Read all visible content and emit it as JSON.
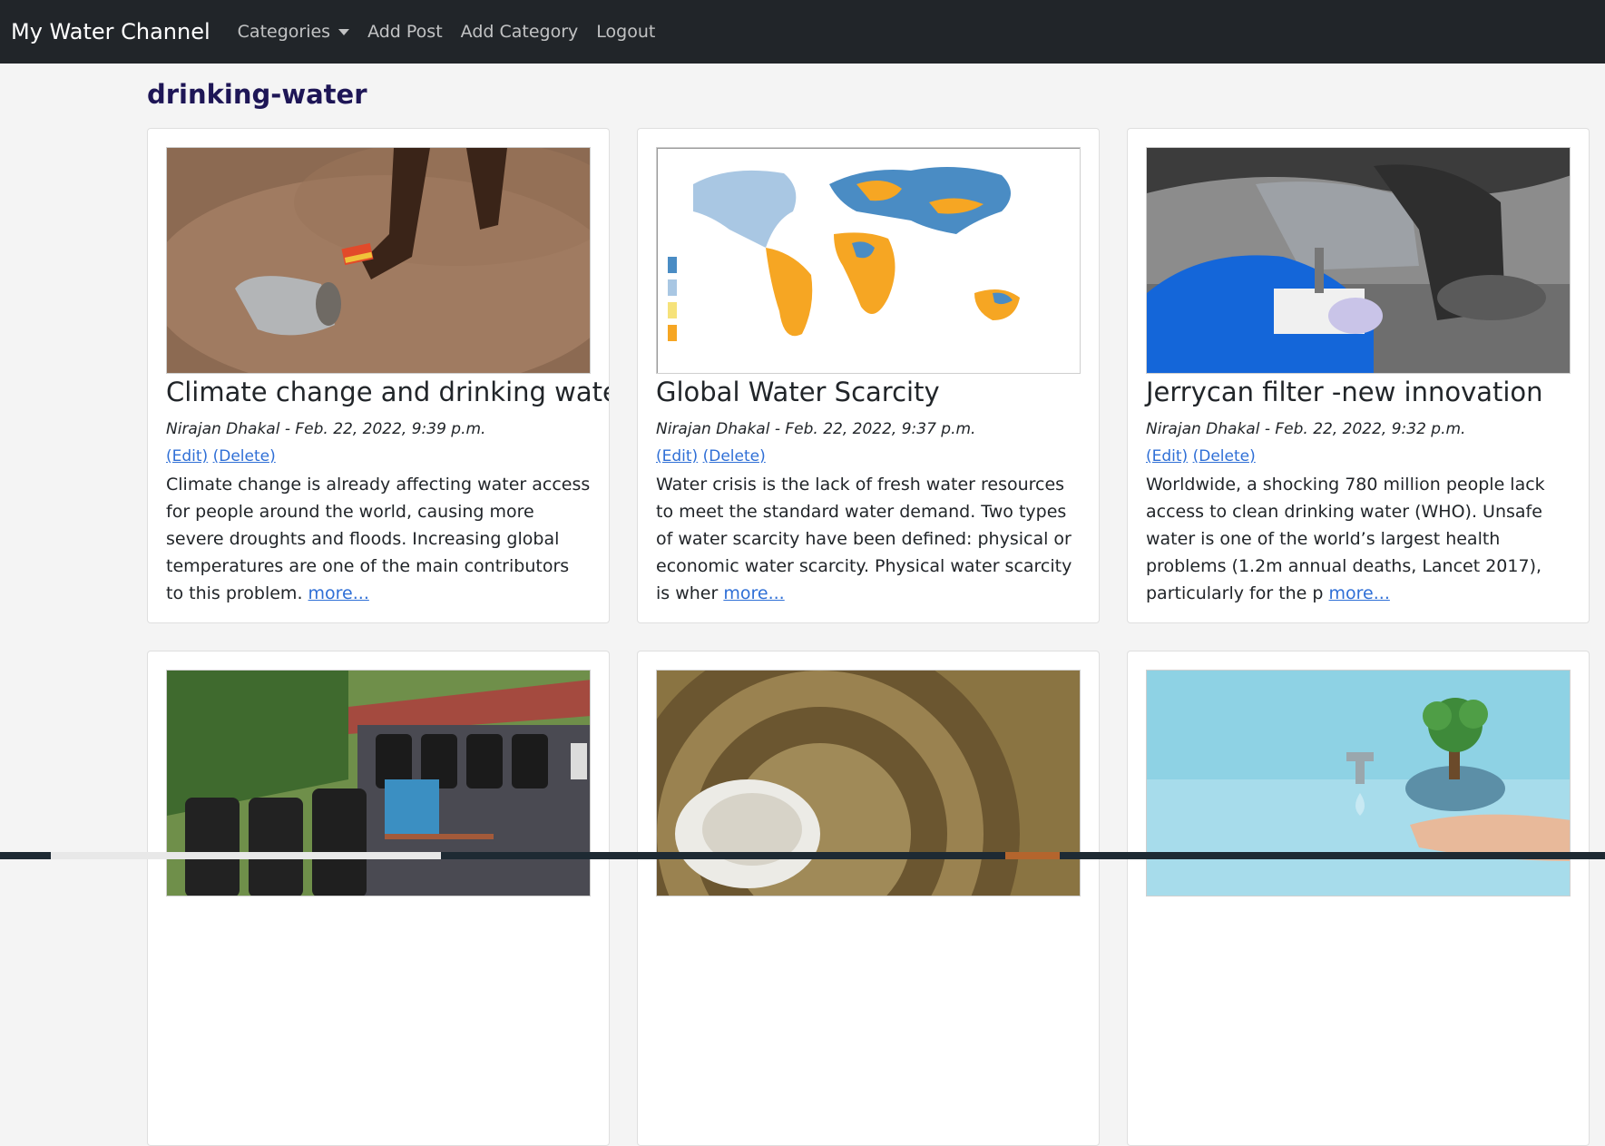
{
  "nav": {
    "brand": "My Water Channel",
    "categories_label": "Categories",
    "add_post_label": "Add Post",
    "add_category_label": "Add Category",
    "logout_label": "Logout"
  },
  "page": {
    "title": "drinking-water"
  },
  "posts": [
    {
      "title": "Climate change and drinking water",
      "meta": "Nirajan Dhakal - Feb. 22, 2022, 9:39 p.m.",
      "edit_label": "(Edit)",
      "delete_label": "(Delete)",
      "excerpt": "Climate change is already affecting water access for people around the world, causing more severe droughts and floods. Increasing global temperatures are one of the main contributors to this problem.",
      "more_label": "more..."
    },
    {
      "title": "Global Water Scarcity",
      "meta": "Nirajan Dhakal - Feb. 22, 2022, 9:37 p.m.",
      "edit_label": "(Edit)",
      "delete_label": "(Delete)",
      "excerpt": "Water crisis is the lack of fresh water resources to meet the standard water demand. Two types of water scarcity have been defined: physical or economic water scarcity. Physical water scarcity is wher",
      "more_label": "more..."
    },
    {
      "title": "Jerrycan filter -new innovation",
      "meta": "Nirajan Dhakal - Feb. 22, 2022, 9:32 p.m.",
      "edit_label": "(Edit)",
      "delete_label": "(Delete)",
      "excerpt": "Worldwide, a shocking 780 million people lack access to clean drinking water (WHO). Unsafe water is one of the world’s largest health problems (1.2m annual deaths, Lancet 2017), particularly for the p",
      "more_label": "more..."
    }
  ],
  "colors": {
    "navbar": "#212529",
    "title": "#1e1656",
    "link": "#2f6fd6",
    "background": "#f4f4f4"
  }
}
